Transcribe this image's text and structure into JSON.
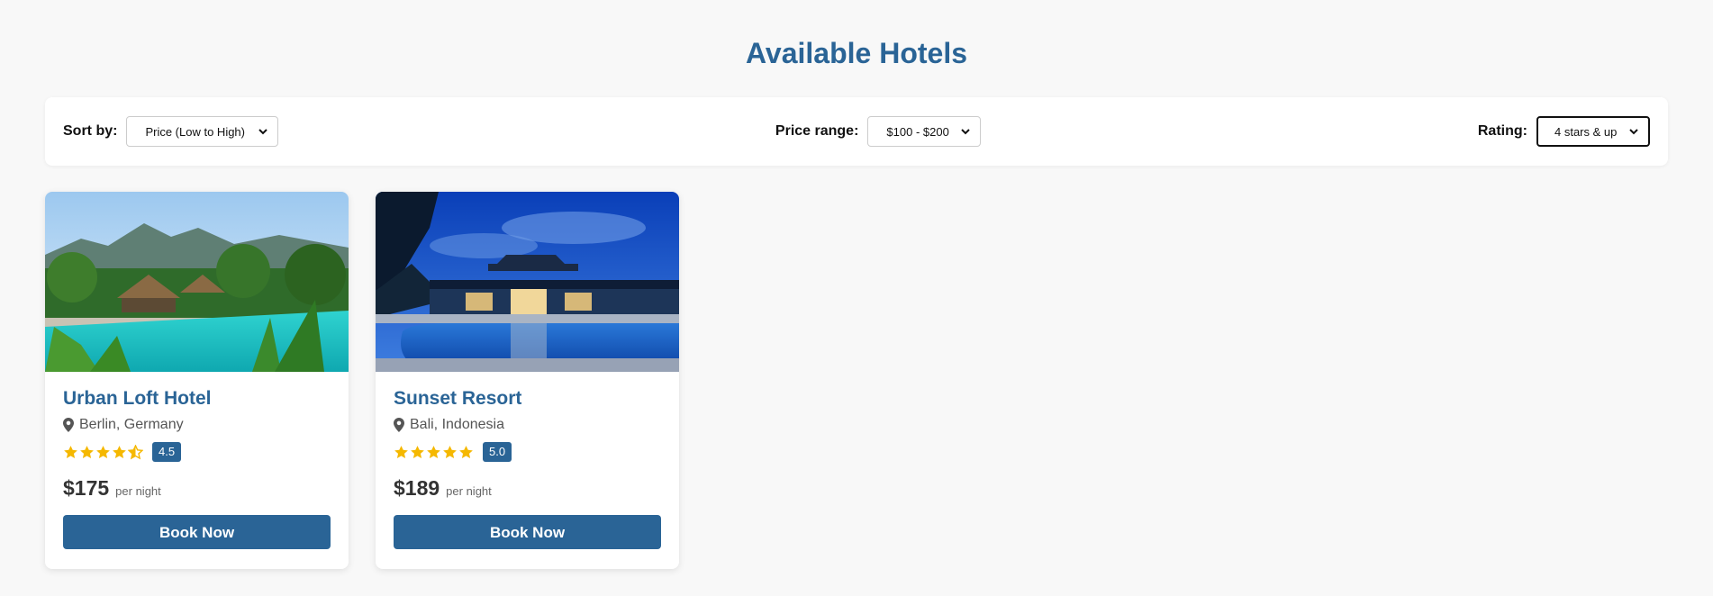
{
  "header": {
    "title": "Available Hotels"
  },
  "filters": {
    "sort": {
      "label": "Sort by:",
      "value": "Price (Low to High)"
    },
    "price": {
      "label": "Price range:",
      "value": "$100 - $200"
    },
    "rating": {
      "label": "Rating:",
      "value": "4 stars & up"
    }
  },
  "hotels": [
    {
      "name": "Urban Loft Hotel",
      "location": "Berlin, Germany",
      "rating": 4.5,
      "rating_label": "4.5",
      "price": "$175",
      "per_night": "per night",
      "book_label": "Book Now",
      "image": "tropical-resort-pool-photo"
    },
    {
      "name": "Sunset Resort",
      "location": "Bali, Indonesia",
      "rating": 5.0,
      "rating_label": "5.0",
      "price": "$189",
      "per_night": "per night",
      "book_label": "Book Now",
      "image": "night-resort-pool-photo"
    }
  ],
  "colors": {
    "accent": "#2a6496",
    "star": "#f5b800",
    "background": "#f8f8f8"
  },
  "icons": {
    "location": "map-pin-icon",
    "star": "star-icon",
    "dropdown": "chevron-down-icon"
  }
}
